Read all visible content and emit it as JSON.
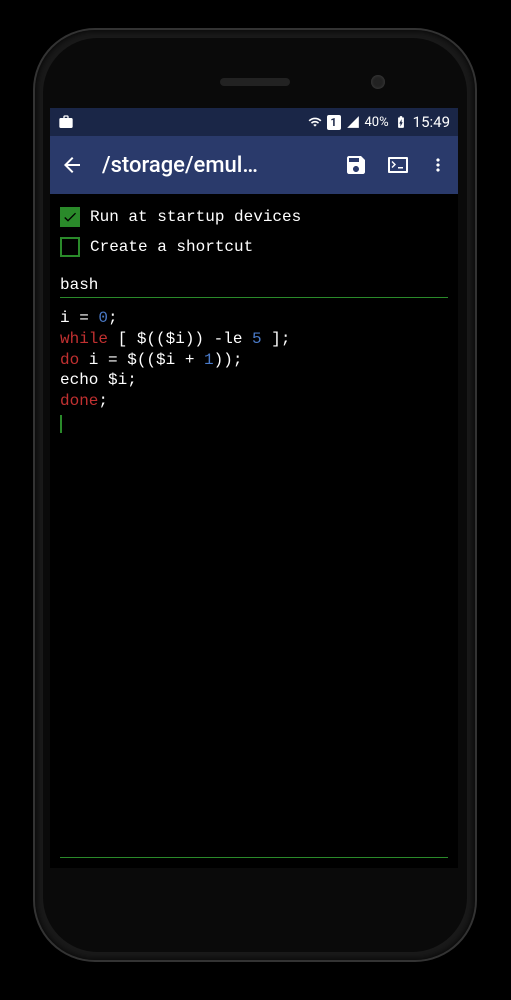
{
  "status_bar": {
    "battery_pct": "40%",
    "clock": "15:49",
    "sim_number": "1"
  },
  "app_bar": {
    "title": "/storage/emul…"
  },
  "checkboxes": {
    "startup": {
      "label": "Run at startup devices",
      "checked": true
    },
    "shortcut": {
      "label": "Create a shortcut",
      "checked": false
    }
  },
  "script": {
    "language": "bash"
  },
  "code": {
    "line1_var": "i",
    "line1_eq": " = ",
    "line1_val": "0",
    "line1_semi": ";",
    "line2_kw": "while",
    "line2_rest1": " [ $(($i)) -le ",
    "line2_num": "5",
    "line2_rest2": " ];",
    "line3_kw": "do",
    "line3_rest1": " i = $(($i + ",
    "line3_num": "1",
    "line3_rest2": "));",
    "line4": "echo $i;",
    "line5_kw": "done",
    "line5_semi": ";"
  }
}
